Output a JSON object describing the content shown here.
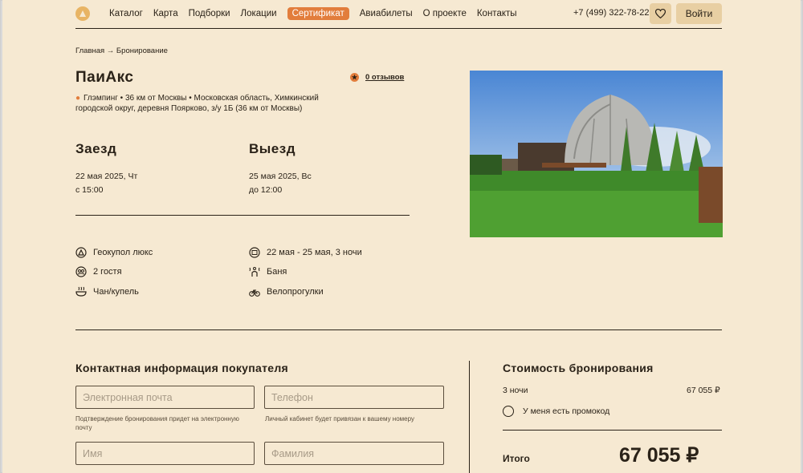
{
  "nav": {
    "links": [
      "Каталог",
      "Карта",
      "Подборки",
      "Локации"
    ],
    "certificate": "Сертификат",
    "links2": [
      "Авиабилеты",
      "О проекте",
      "Контакты"
    ],
    "phone": "+7 (499) 322-78-22",
    "login": "Войти"
  },
  "breadcrumb": "Главная → Бронирование",
  "place": {
    "name": "ПаиАкс",
    "reviews": "0 отзывов",
    "address": "Глэмпинг  • 36 км от Москвы  • Московская область, Химкинский городской округ, деревня Поярково, з/у 1Б (36 км от Москвы)"
  },
  "checkin": {
    "label": "Заезд",
    "date": "22 мая 2025, Чт",
    "time": "с 15:00"
  },
  "checkout": {
    "label": "Выезд",
    "date": "25 мая 2025, Вс",
    "time": "до 12:00"
  },
  "amenities": {
    "left": [
      {
        "icon": "house-icon",
        "text": "Геокупол люкс"
      },
      {
        "icon": "guests-icon",
        "text": "2 гостя"
      },
      {
        "icon": "tub-icon",
        "text": "Чан/купель"
      }
    ],
    "right": [
      {
        "icon": "calendar-icon",
        "text": "22 мая - 25 мая, 3 ночи"
      },
      {
        "icon": "sauna-icon",
        "text": "Баня"
      },
      {
        "icon": "bike-icon",
        "text": "Велопрогулки"
      }
    ]
  },
  "contact": {
    "title": "Контактная информация покупателя",
    "email_placeholder": "Электронная почта",
    "email_hint": "Подтверждение бронирования придет на электронную почту",
    "phone_placeholder": "Телефон",
    "phone_hint": "Личный кабинет будет привязан к вашему номеру",
    "name_placeholder": "Имя",
    "surname_placeholder": "Фамилия"
  },
  "cost": {
    "title": "Стоимость бронирования",
    "nights": "3 ночи",
    "nights_price": "67 055 ₽",
    "promo": "У меня есть промокод",
    "total_label": "Итого",
    "total": "67 055 ₽"
  },
  "colors": {
    "background": "#f6e9d2",
    "accent": "#e27d3c",
    "button": "#e8cfa3"
  }
}
